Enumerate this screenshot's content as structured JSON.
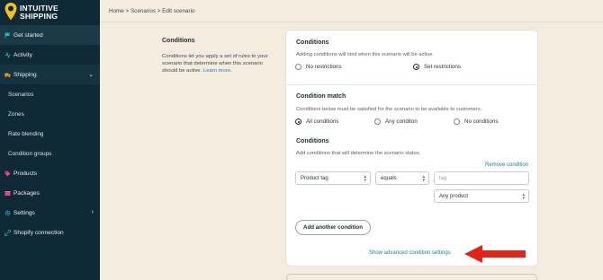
{
  "sidebar": {
    "logo_line1": "INTUITIVE",
    "logo_line2": "SHIPPING",
    "items": [
      {
        "label": "Get started",
        "icon": "flag-icon"
      },
      {
        "label": "Activity",
        "icon": "activity-icon"
      },
      {
        "label": "Shipping",
        "icon": "truck-icon"
      },
      {
        "label": "Scenarios"
      },
      {
        "label": "Zones"
      },
      {
        "label": "Rate blending"
      },
      {
        "label": "Condition groups"
      },
      {
        "label": "Products",
        "icon": "tag-icon"
      },
      {
        "label": "Packages",
        "icon": "package-icon"
      },
      {
        "label": "Settings",
        "icon": "gear-icon"
      },
      {
        "label": "Shopify connection",
        "icon": "link-icon"
      }
    ]
  },
  "breadcrumb": "Home > Scenarios > Edit scenario",
  "section": {
    "title": "Conditions",
    "description": "Conditions let you apply a set of rules to your scenario that determine when this scenario should be active.",
    "learn_more": "Learn more."
  },
  "card": {
    "conditions_title": "Conditions",
    "conditions_desc": "Adding conditions will limit when this scenario will be active.",
    "restriction_options": [
      "No restrictions",
      "Set restrictions"
    ],
    "restriction_selected": "Set restrictions",
    "match_title": "Condition match",
    "match_desc": "Conditions below must be satisfied for the scenario to be available to customers.",
    "match_options": [
      "All conditions",
      "Any conditon",
      "No conditions"
    ],
    "match_selected": "All conditions",
    "conditions2_title": "Conditions",
    "conditions2_desc": "Add conditions that will determine the scenario status.",
    "remove_condition": "Remove condition",
    "field_select": "Product tag",
    "operator_select": "equals",
    "tag_placeholder": "tag",
    "product_select": "Any product",
    "add_button": "Add another condition",
    "advanced_link": "Show advanced condition settings"
  },
  "colors": {
    "sidebar_bg": "#0f2a36",
    "page_bg": "#f4ecdf",
    "link": "#1b7fa6",
    "logo_accent": "#f2c21b",
    "annotation_arrow": "#e2231a"
  }
}
